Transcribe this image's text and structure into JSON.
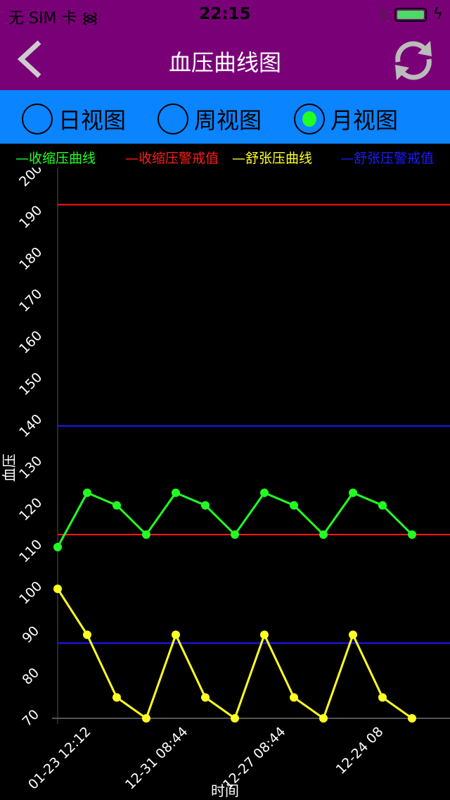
{
  "status": {
    "carrier": "无 SIM 卡",
    "time": "22:15",
    "battery_color": "#4cd964"
  },
  "nav": {
    "title": "血压曲线图",
    "back_icon": "chevron-left-icon",
    "refresh_icon": "refresh-icon",
    "bg": "#7a0078"
  },
  "tabs": [
    {
      "label": "日视图",
      "selected": false
    },
    {
      "label": "周视图",
      "selected": false
    },
    {
      "label": "月视图",
      "selected": true
    }
  ],
  "legend": [
    {
      "label": "—收缩压曲线",
      "color": "#22ff22"
    },
    {
      "label": "—收缩压警戒值",
      "color": "#ff1a1a"
    },
    {
      "label": "—舒张压曲线",
      "color": "#ffff22"
    },
    {
      "label": "—舒张压警戒值",
      "color": "#1a1aff"
    }
  ],
  "chart_data": {
    "type": "line",
    "ylabel": "血压",
    "xlabel": "时间",
    "ylim": [
      70,
      200
    ],
    "yticks": [
      70,
      80,
      90,
      100,
      110,
      120,
      130,
      140,
      150,
      160,
      170,
      180,
      190,
      200
    ],
    "xtick_labels": [
      "01-23 12:12",
      "12-31 08:44",
      "12-27 08:44",
      "12-24 08"
    ],
    "series": [
      {
        "color": "#22ff22",
        "values": [
          111,
          124,
          121,
          114,
          124,
          121,
          114,
          124,
          121,
          114,
          124,
          121,
          114
        ]
      },
      {
        "color": "#ffff22",
        "values": [
          101,
          90,
          75,
          70,
          90,
          75,
          70,
          90,
          75,
          70,
          90,
          75,
          70
        ]
      }
    ],
    "thresholds": [
      {
        "color": "#ff1a1a",
        "value": 193
      },
      {
        "color": "#ff1a1a",
        "value": 114
      },
      {
        "color": "#1a1aff",
        "value": 140
      },
      {
        "color": "#1a1aff",
        "value": 88
      }
    ]
  }
}
